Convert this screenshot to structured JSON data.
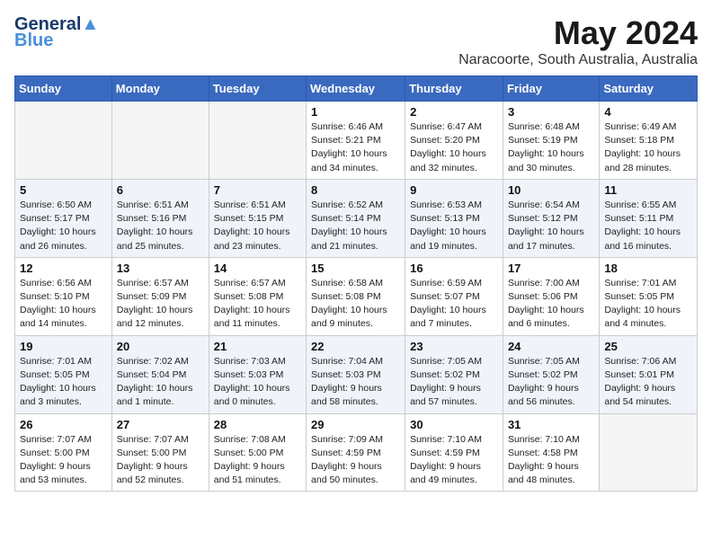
{
  "logo": {
    "line1": "General",
    "line2": "Blue"
  },
  "title": "May 2024",
  "location": "Naracoorte, South Australia, Australia",
  "days_header": [
    "Sunday",
    "Monday",
    "Tuesday",
    "Wednesday",
    "Thursday",
    "Friday",
    "Saturday"
  ],
  "weeks": [
    [
      {
        "day": "",
        "info": ""
      },
      {
        "day": "",
        "info": ""
      },
      {
        "day": "",
        "info": ""
      },
      {
        "day": "1",
        "info": "Sunrise: 6:46 AM\nSunset: 5:21 PM\nDaylight: 10 hours\nand 34 minutes."
      },
      {
        "day": "2",
        "info": "Sunrise: 6:47 AM\nSunset: 5:20 PM\nDaylight: 10 hours\nand 32 minutes."
      },
      {
        "day": "3",
        "info": "Sunrise: 6:48 AM\nSunset: 5:19 PM\nDaylight: 10 hours\nand 30 minutes."
      },
      {
        "day": "4",
        "info": "Sunrise: 6:49 AM\nSunset: 5:18 PM\nDaylight: 10 hours\nand 28 minutes."
      }
    ],
    [
      {
        "day": "5",
        "info": "Sunrise: 6:50 AM\nSunset: 5:17 PM\nDaylight: 10 hours\nand 26 minutes."
      },
      {
        "day": "6",
        "info": "Sunrise: 6:51 AM\nSunset: 5:16 PM\nDaylight: 10 hours\nand 25 minutes."
      },
      {
        "day": "7",
        "info": "Sunrise: 6:51 AM\nSunset: 5:15 PM\nDaylight: 10 hours\nand 23 minutes."
      },
      {
        "day": "8",
        "info": "Sunrise: 6:52 AM\nSunset: 5:14 PM\nDaylight: 10 hours\nand 21 minutes."
      },
      {
        "day": "9",
        "info": "Sunrise: 6:53 AM\nSunset: 5:13 PM\nDaylight: 10 hours\nand 19 minutes."
      },
      {
        "day": "10",
        "info": "Sunrise: 6:54 AM\nSunset: 5:12 PM\nDaylight: 10 hours\nand 17 minutes."
      },
      {
        "day": "11",
        "info": "Sunrise: 6:55 AM\nSunset: 5:11 PM\nDaylight: 10 hours\nand 16 minutes."
      }
    ],
    [
      {
        "day": "12",
        "info": "Sunrise: 6:56 AM\nSunset: 5:10 PM\nDaylight: 10 hours\nand 14 minutes."
      },
      {
        "day": "13",
        "info": "Sunrise: 6:57 AM\nSunset: 5:09 PM\nDaylight: 10 hours\nand 12 minutes."
      },
      {
        "day": "14",
        "info": "Sunrise: 6:57 AM\nSunset: 5:08 PM\nDaylight: 10 hours\nand 11 minutes."
      },
      {
        "day": "15",
        "info": "Sunrise: 6:58 AM\nSunset: 5:08 PM\nDaylight: 10 hours\nand 9 minutes."
      },
      {
        "day": "16",
        "info": "Sunrise: 6:59 AM\nSunset: 5:07 PM\nDaylight: 10 hours\nand 7 minutes."
      },
      {
        "day": "17",
        "info": "Sunrise: 7:00 AM\nSunset: 5:06 PM\nDaylight: 10 hours\nand 6 minutes."
      },
      {
        "day": "18",
        "info": "Sunrise: 7:01 AM\nSunset: 5:05 PM\nDaylight: 10 hours\nand 4 minutes."
      }
    ],
    [
      {
        "day": "19",
        "info": "Sunrise: 7:01 AM\nSunset: 5:05 PM\nDaylight: 10 hours\nand 3 minutes."
      },
      {
        "day": "20",
        "info": "Sunrise: 7:02 AM\nSunset: 5:04 PM\nDaylight: 10 hours\nand 1 minute."
      },
      {
        "day": "21",
        "info": "Sunrise: 7:03 AM\nSunset: 5:03 PM\nDaylight: 10 hours\nand 0 minutes."
      },
      {
        "day": "22",
        "info": "Sunrise: 7:04 AM\nSunset: 5:03 PM\nDaylight: 9 hours\nand 58 minutes."
      },
      {
        "day": "23",
        "info": "Sunrise: 7:05 AM\nSunset: 5:02 PM\nDaylight: 9 hours\nand 57 minutes."
      },
      {
        "day": "24",
        "info": "Sunrise: 7:05 AM\nSunset: 5:02 PM\nDaylight: 9 hours\nand 56 minutes."
      },
      {
        "day": "25",
        "info": "Sunrise: 7:06 AM\nSunset: 5:01 PM\nDaylight: 9 hours\nand 54 minutes."
      }
    ],
    [
      {
        "day": "26",
        "info": "Sunrise: 7:07 AM\nSunset: 5:00 PM\nDaylight: 9 hours\nand 53 minutes."
      },
      {
        "day": "27",
        "info": "Sunrise: 7:07 AM\nSunset: 5:00 PM\nDaylight: 9 hours\nand 52 minutes."
      },
      {
        "day": "28",
        "info": "Sunrise: 7:08 AM\nSunset: 5:00 PM\nDaylight: 9 hours\nand 51 minutes."
      },
      {
        "day": "29",
        "info": "Sunrise: 7:09 AM\nSunset: 4:59 PM\nDaylight: 9 hours\nand 50 minutes."
      },
      {
        "day": "30",
        "info": "Sunrise: 7:10 AM\nSunset: 4:59 PM\nDaylight: 9 hours\nand 49 minutes."
      },
      {
        "day": "31",
        "info": "Sunrise: 7:10 AM\nSunset: 4:58 PM\nDaylight: 9 hours\nand 48 minutes."
      },
      {
        "day": "",
        "info": ""
      }
    ]
  ]
}
